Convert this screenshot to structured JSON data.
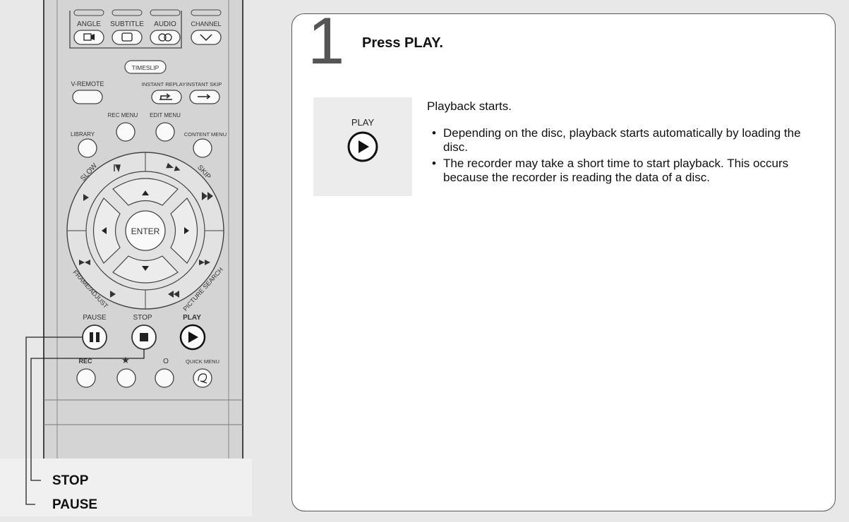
{
  "remote": {
    "angle_label": "ANGLE",
    "subtitle_label": "SUBTITLE",
    "audio_label": "AUDIO",
    "channel_label": "CHANNEL",
    "timeslip_label": "TIMESLIP",
    "vremote_label": "V-REMOTE",
    "instant_replay_label": "INSTANT REPLAY",
    "instant_skip_label": "INSTANT SKIP",
    "rec_menu_label": "REC MENU",
    "edit_menu_label": "EDIT MENU",
    "library_label": "LIBRARY",
    "content_menu_label": "CONTENT MENU",
    "slow_label": "SLOW",
    "skip_label": "SKIP",
    "enter_label": "ENTER",
    "frame_adjust_label": "FRAME/ADJUST",
    "picture_search_label": "PICTURE SEARCH",
    "pause_label": "PAUSE",
    "stop_label": "STOP",
    "play_label": "PLAY",
    "rec_label": "REC",
    "star_label": "★",
    "circle_label": "O",
    "quick_menu_label": "QUICK MENU"
  },
  "callouts": {
    "stop": "STOP",
    "pause": "PAUSE"
  },
  "step": {
    "number": "1",
    "title": "Press PLAY.",
    "button_caption": "PLAY",
    "intro": "Playback starts.",
    "bullets": [
      "Depending on the disc, playback starts automatically by loading the disc.",
      "The recorder may take a short time to start playback. This occurs because the recorder is reading the data of a disc."
    ]
  }
}
